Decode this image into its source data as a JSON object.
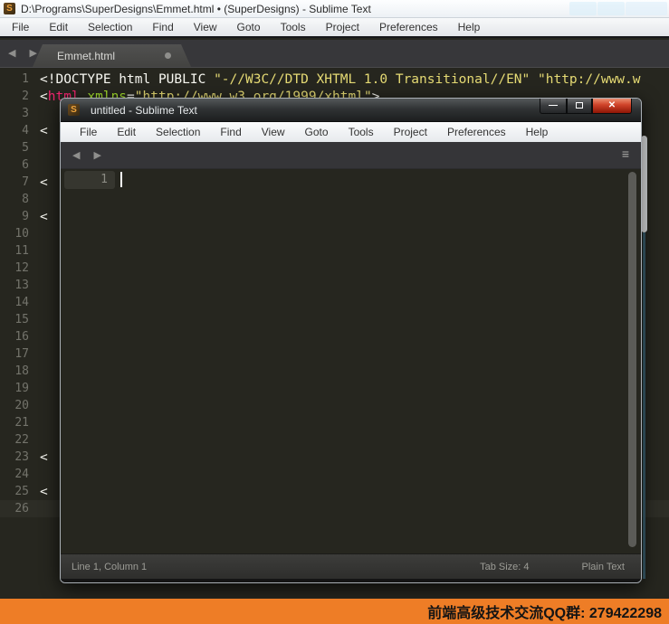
{
  "outer": {
    "title": "D:\\Programs\\SuperDesigns\\Emmet.html • (SuperDesigns) - Sublime Text",
    "app_icon_letter": "S",
    "menu": [
      "File",
      "Edit",
      "Selection",
      "Find",
      "View",
      "Goto",
      "Tools",
      "Project",
      "Preferences",
      "Help"
    ],
    "tab": {
      "label": "Emmet.html"
    },
    "editor": {
      "lines": [
        {
          "num": "1",
          "current": false,
          "tokens": [
            {
              "text": "<!DOCTYPE html PUBLIC ",
              "color": "#f8f8f2"
            },
            {
              "text": "\"-//W3C//DTD XHTML 1.0 Transitional//EN\"",
              "color": "#e6db74"
            },
            {
              "text": " ",
              "color": "#f8f8f2"
            },
            {
              "text": "\"http://www.w",
              "color": "#e6db74"
            }
          ]
        },
        {
          "num": "2",
          "current": false,
          "tokens": [
            {
              "text": "<",
              "color": "#f8f8f2"
            },
            {
              "text": "html",
              "color": "#f92672"
            },
            {
              "text": " ",
              "color": "#f8f8f2"
            },
            {
              "text": "xmlns",
              "color": "#a6e22e"
            },
            {
              "text": "=",
              "color": "#f8f8f2"
            },
            {
              "text": "\"http://www.w3.org/1999/xhtml\"",
              "color": "#e6db74"
            },
            {
              "text": ">",
              "color": "#f8f8f2"
            }
          ]
        },
        {
          "num": "3",
          "current": false,
          "tokens": []
        },
        {
          "num": "4",
          "current": false,
          "tokens": [
            {
              "text": "<",
              "color": "#f8f8f2"
            }
          ]
        },
        {
          "num": "5",
          "current": false,
          "tokens": []
        },
        {
          "num": "6",
          "current": false,
          "tokens": []
        },
        {
          "num": "7",
          "current": false,
          "tokens": [
            {
              "text": "<",
              "color": "#f8f8f2"
            }
          ]
        },
        {
          "num": "8",
          "current": false,
          "tokens": []
        },
        {
          "num": "9",
          "current": false,
          "tokens": [
            {
              "text": "<",
              "color": "#f8f8f2"
            }
          ]
        },
        {
          "num": "10",
          "current": false,
          "tokens": []
        },
        {
          "num": "11",
          "current": false,
          "tokens": []
        },
        {
          "num": "12",
          "current": false,
          "tokens": []
        },
        {
          "num": "13",
          "current": false,
          "tokens": []
        },
        {
          "num": "14",
          "current": false,
          "tokens": []
        },
        {
          "num": "15",
          "current": false,
          "tokens": []
        },
        {
          "num": "16",
          "current": false,
          "tokens": []
        },
        {
          "num": "17",
          "current": false,
          "tokens": []
        },
        {
          "num": "18",
          "current": false,
          "tokens": []
        },
        {
          "num": "19",
          "current": false,
          "tokens": []
        },
        {
          "num": "20",
          "current": false,
          "tokens": []
        },
        {
          "num": "21",
          "current": false,
          "tokens": []
        },
        {
          "num": "22",
          "current": false,
          "tokens": []
        },
        {
          "num": "23",
          "current": false,
          "tokens": [
            {
              "text": "<",
              "color": "#f8f8f2"
            }
          ]
        },
        {
          "num": "24",
          "current": false,
          "tokens": []
        },
        {
          "num": "25",
          "current": false,
          "tokens": [
            {
              "text": "<",
              "color": "#f8f8f2"
            }
          ]
        },
        {
          "num": "26",
          "current": true,
          "tokens": []
        }
      ]
    }
  },
  "popup": {
    "title": "untitled - Sublime Text",
    "app_icon_letter": "S",
    "menu": [
      "File",
      "Edit",
      "Selection",
      "Find",
      "View",
      "Goto",
      "Tools",
      "Project",
      "Preferences",
      "Help"
    ],
    "window_buttons": {
      "minimize": "—",
      "close": "✕"
    },
    "nav_arrows": "◀ ▶",
    "overflow_icon": "≡",
    "gutter_line": "1",
    "status": {
      "position": "Line 1, Column 1",
      "tab_size": "Tab Size: 4",
      "syntax": "Plain Text"
    }
  },
  "banner": {
    "text": "前端高级技术交流QQ群: 279422298",
    "bg": "#ee7d26"
  },
  "colors": {
    "editor_bg": "#26261f",
    "string": "#e6db74",
    "tag": "#f92672",
    "attr": "#a6e22e",
    "plain": "#f8f8f2"
  }
}
